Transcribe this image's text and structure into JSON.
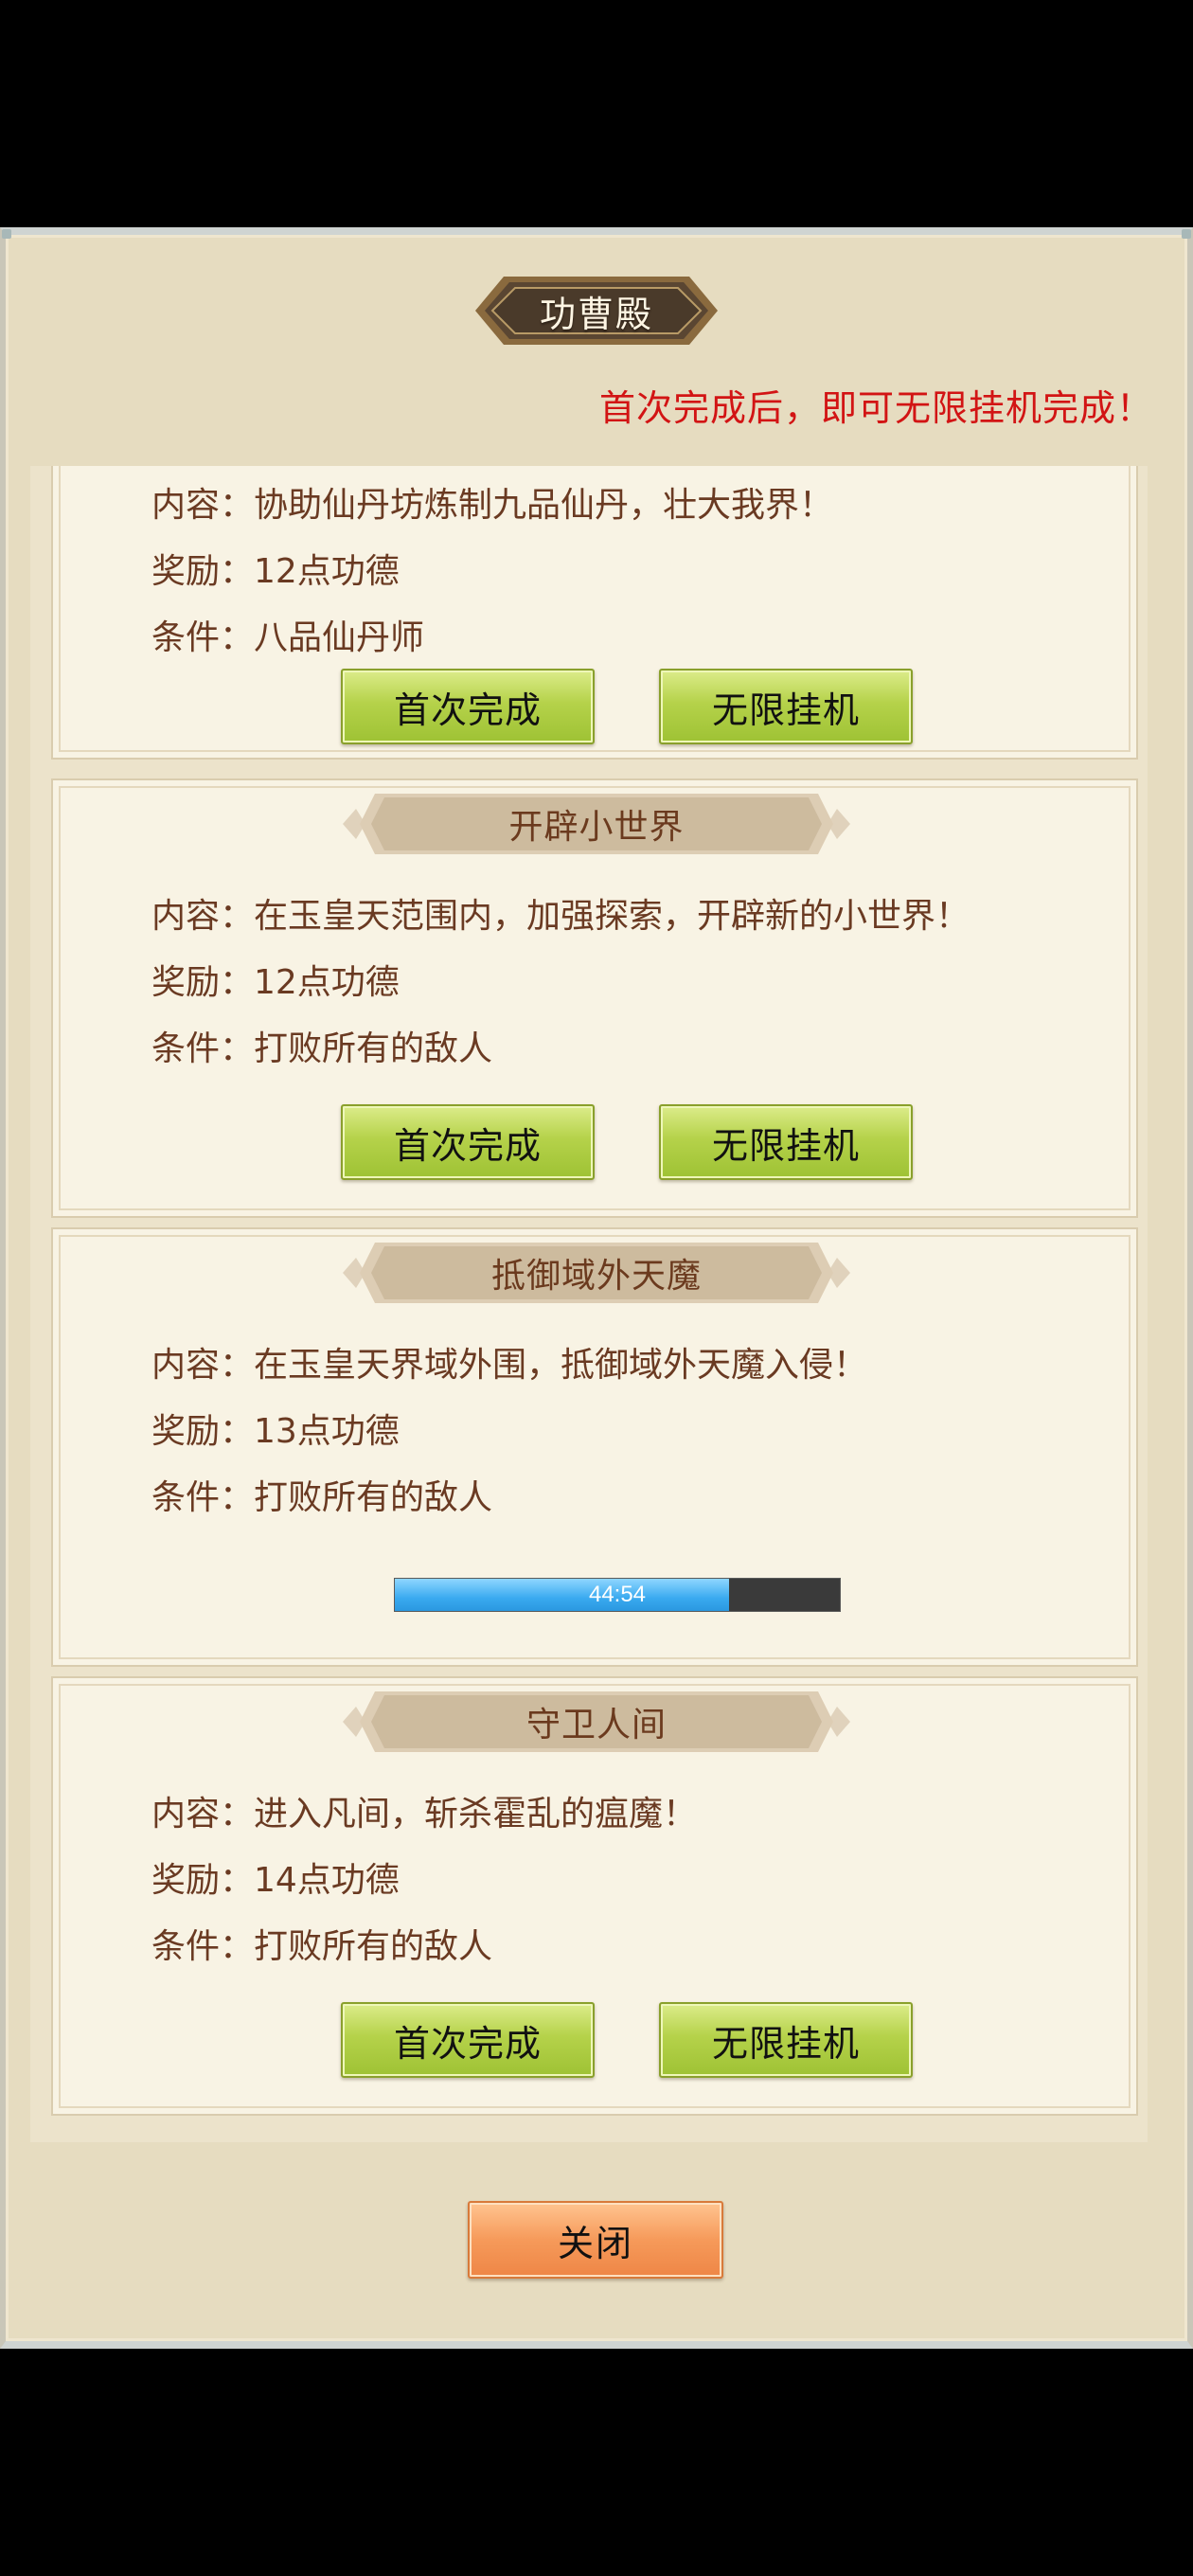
{
  "header": {
    "title": "功曹殿"
  },
  "notice": "首次完成后，即可无限挂机完成！",
  "tasks": [
    {
      "title": "",
      "content": "内容：协助仙丹坊炼制九品仙丹，壮大我界！",
      "reward": "奖励：12点功德",
      "condition": "条件：八品仙丹师",
      "first_label": "首次完成",
      "idle_label": "无限挂机"
    },
    {
      "title": "开辟小世界",
      "content": "内容：在玉皇天范围内，加强探索，开辟新的小世界！",
      "reward": "奖励：12点功德",
      "condition": "条件：打败所有的敌人",
      "first_label": "首次完成",
      "idle_label": "无限挂机"
    },
    {
      "title": "抵御域外天魔",
      "content": "内容：在玉皇天界域外围，抵御域外天魔入侵！",
      "reward": "奖励：13点功德",
      "condition": "条件：打败所有的敌人",
      "timer": "44:54",
      "progress": 0.75
    },
    {
      "title": "守卫人间",
      "content": "内容：进入凡间，斩杀霍乱的瘟魔！",
      "reward": "奖励：14点功德",
      "condition": "条件：打败所有的敌人",
      "first_label": "首次完成",
      "idle_label": "无限挂机"
    }
  ],
  "close_label": "关闭",
  "colors": {
    "notice": "#d21414",
    "button_green": "#b5d24a",
    "button_orange": "#f69a5a",
    "progress_blue": "#3aaaf0"
  }
}
